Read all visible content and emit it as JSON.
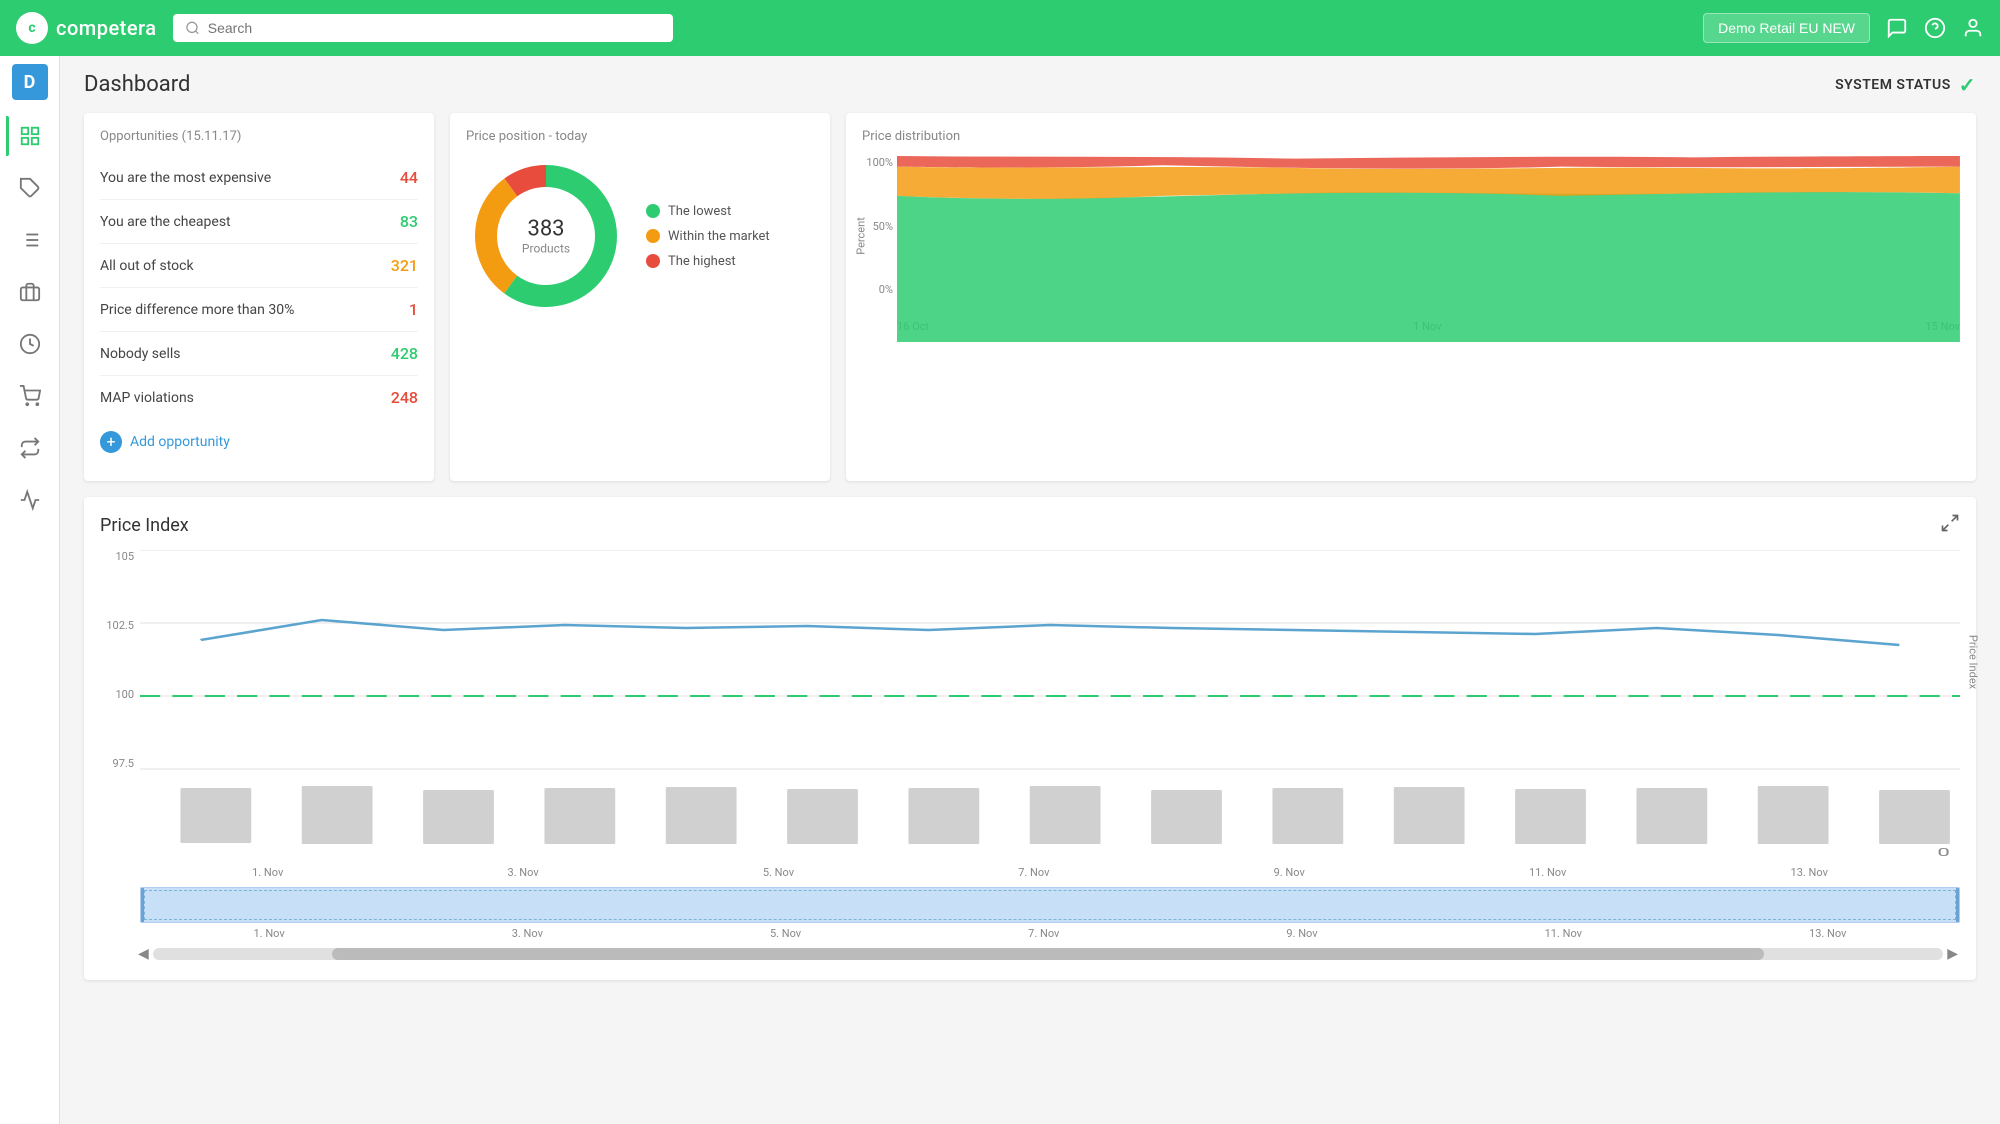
{
  "app": {
    "logo_text": "competera",
    "logo_initial": "c"
  },
  "nav": {
    "search_placeholder": "Search",
    "store_label": "Demo Retail EU NEW"
  },
  "sidebar": {
    "avatar_initial": "D",
    "items": [
      {
        "name": "dashboard",
        "active": true,
        "icon": "⊞"
      },
      {
        "name": "tag",
        "icon": "🏷"
      },
      {
        "name": "list",
        "icon": "☰"
      },
      {
        "name": "briefcase",
        "icon": "💼"
      },
      {
        "name": "clock",
        "icon": "🕐"
      },
      {
        "name": "cart",
        "icon": "🛒"
      },
      {
        "name": "exchange",
        "icon": "⇅"
      },
      {
        "name": "analytics",
        "icon": "📈"
      }
    ]
  },
  "header": {
    "title": "Dashboard",
    "system_status_label": "SYSTEM STATUS"
  },
  "opportunities": {
    "card_title": "Opportunities (15.11.17)",
    "items": [
      {
        "label": "You are the most expensive",
        "count": "44",
        "count_class": "count-red"
      },
      {
        "label": "You are the cheapest",
        "count": "83",
        "count_class": "count-green"
      },
      {
        "label": "All out of stock",
        "count": "321",
        "count_class": "count-orange"
      },
      {
        "label": "Price difference more than 30%",
        "count": "1",
        "count_class": "count-red"
      },
      {
        "label": "Nobody sells",
        "count": "428",
        "count_class": "count-green"
      },
      {
        "label": "MAP violations",
        "count": "248",
        "count_class": "count-red"
      }
    ],
    "add_label": "Add opportunity"
  },
  "price_position": {
    "card_title": "Price position - today",
    "donut_number": "383",
    "donut_sub": "Products",
    "legend": [
      {
        "label": "The lowest",
        "color": "#2ecc71"
      },
      {
        "label": "Within the market",
        "color": "#f39c12"
      },
      {
        "label": "The highest",
        "color": "#e74c3c"
      }
    ],
    "donut_segments": [
      {
        "label": "lowest",
        "value": 60,
        "color": "#2ecc71"
      },
      {
        "label": "market",
        "value": 30,
        "color": "#f39c12"
      },
      {
        "label": "highest",
        "value": 10,
        "color": "#e74c3c"
      }
    ]
  },
  "price_distribution": {
    "card_title": "Price distribution",
    "y_labels": [
      "100%",
      "50%",
      "0%"
    ],
    "x_labels": [
      "16 Oct",
      "1 Nov",
      "15 Nov"
    ],
    "y_axis_title": "Percent"
  },
  "price_index": {
    "title": "Price Index",
    "y_values": [
      "105",
      "102.5",
      "100",
      "97.5"
    ],
    "x_labels": [
      "1. Nov",
      "3. Nov",
      "5. Nov",
      "7. Nov",
      "9. Nov",
      "11. Nov",
      "13. Nov"
    ],
    "scroll_x_labels": [
      "1. Nov",
      "3. Nov",
      "5. Nov",
      "7. Nov",
      "9. Nov",
      "11. Nov",
      "13. Nov"
    ],
    "y_axis_title": "Price Index",
    "bar_y_value": "0"
  }
}
